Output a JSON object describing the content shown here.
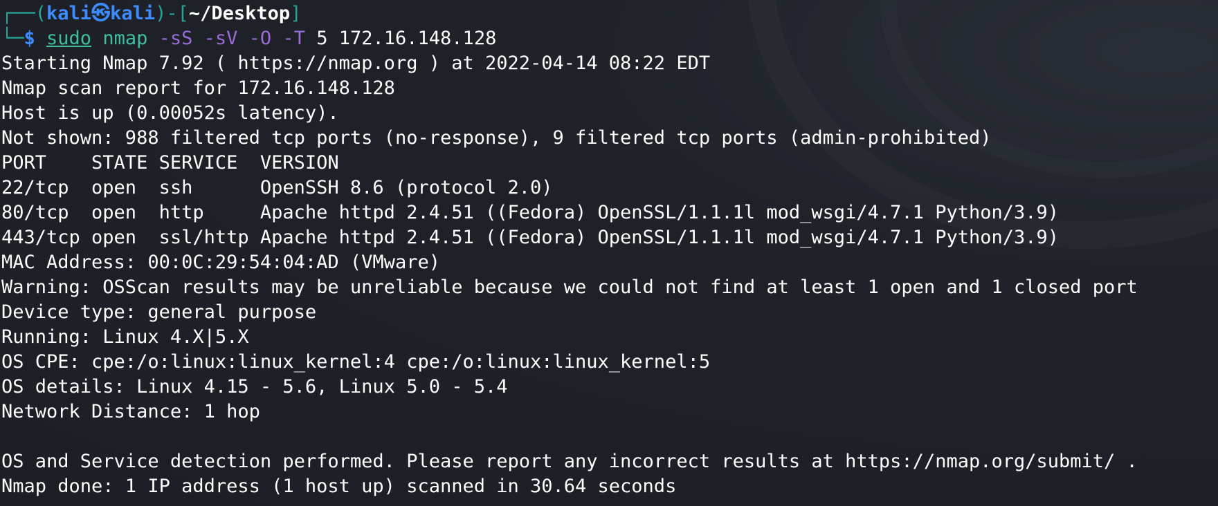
{
  "prompt": {
    "bracket_open": "┌──(",
    "user": "kali",
    "at_symbol": "㉿",
    "host": "kali",
    "sep": ")-[",
    "path": "~/Desktop",
    "bracket_close": "]",
    "line2_prefix": "└─",
    "dollar": "$ ",
    "cmd_sudo": "sudo",
    "cmd_space": " ",
    "cmd_nmap": "nmap",
    "flag_ss": " -sS",
    "flag_sv": " -sV",
    "flag_o": " -O",
    "flag_t": " -T",
    "args": " 5 172.16.148.128"
  },
  "output": [
    "Starting Nmap 7.92 ( https://nmap.org ) at 2022-04-14 08:22 EDT",
    "Nmap scan report for 172.16.148.128",
    "Host is up (0.00052s latency).",
    "Not shown: 988 filtered tcp ports (no-response), 9 filtered tcp ports (admin-prohibited)",
    "PORT    STATE SERVICE  VERSION",
    "22/tcp  open  ssh      OpenSSH 8.6 (protocol 2.0)",
    "80/tcp  open  http     Apache httpd 2.4.51 ((Fedora) OpenSSL/1.1.1l mod_wsgi/4.7.1 Python/3.9)",
    "443/tcp open  ssl/http Apache httpd 2.4.51 ((Fedora) OpenSSL/1.1.1l mod_wsgi/4.7.1 Python/3.9)",
    "MAC Address: 00:0C:29:54:04:AD (VMware)",
    "Warning: OSScan results may be unreliable because we could not find at least 1 open and 1 closed port",
    "Device type: general purpose",
    "Running: Linux 4.X|5.X",
    "OS CPE: cpe:/o:linux:linux_kernel:4 cpe:/o:linux:linux_kernel:5",
    "OS details: Linux 4.15 - 5.6, Linux 5.0 - 5.4",
    "Network Distance: 1 hop",
    "",
    "OS and Service detection performed. Please report any incorrect results at https://nmap.org/submit/ .",
    "Nmap done: 1 IP address (1 host up) scanned in 30.64 seconds"
  ],
  "colors": {
    "background": "#1f2229",
    "prompt_blue": "#3d8cff",
    "command_green": "#3fbf9f",
    "flag_purple": "#9b6cd9",
    "text": "#ffffff"
  }
}
